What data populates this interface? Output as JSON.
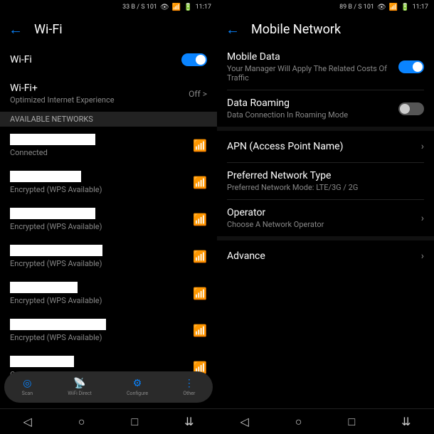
{
  "left": {
    "status": {
      "speed": "33 B / S 101",
      "time": "11:17"
    },
    "header": {
      "title": "Wi-Fi"
    },
    "wifi_toggle": {
      "label": "Wi-Fi",
      "on": true
    },
    "wifi_plus": {
      "label": "Wi-Fi+",
      "sub": "Optimized Internet Experience",
      "value": "Off >"
    },
    "section": "AVAILABLE NETWORKS",
    "networks": [
      {
        "status": "Connected"
      },
      {
        "status": "Encrypted (WPS Available)"
      },
      {
        "status": "Encrypted (WPS Available)"
      },
      {
        "status": "Encrypted (WPS Available)"
      },
      {
        "status": "Encrypted (WPS Available)"
      },
      {
        "status": "Encrypted (WPS Available)"
      },
      {
        "status": "Open"
      }
    ],
    "pill": {
      "scan": "Scan",
      "direct": "WiFi Direct",
      "configure": "Configure",
      "other": "Other"
    }
  },
  "right": {
    "status": {
      "speed": "89 B / S 101",
      "time": "11:17"
    },
    "header": {
      "title": "Mobile Network"
    },
    "mobile_data": {
      "label": "Mobile Data",
      "sub": "Your Manager Will Apply The Related Costs Of Traffic",
      "on": true
    },
    "roaming": {
      "label": "Data Roaming",
      "sub": "Data Connection In Roaming Mode",
      "on": false
    },
    "apn": {
      "label": "APN (Access Point Name)"
    },
    "network_type": {
      "label": "Preferred Network Type",
      "sub": "Preferred Network Mode: LTE/3G / 2G"
    },
    "operator": {
      "label": "Operator",
      "sub": "Choose A Network Operator"
    },
    "advance": {
      "label": "Advance"
    }
  },
  "nav": {
    "back": "◁",
    "home": "○",
    "recent": "□",
    "extra": "⇊"
  }
}
